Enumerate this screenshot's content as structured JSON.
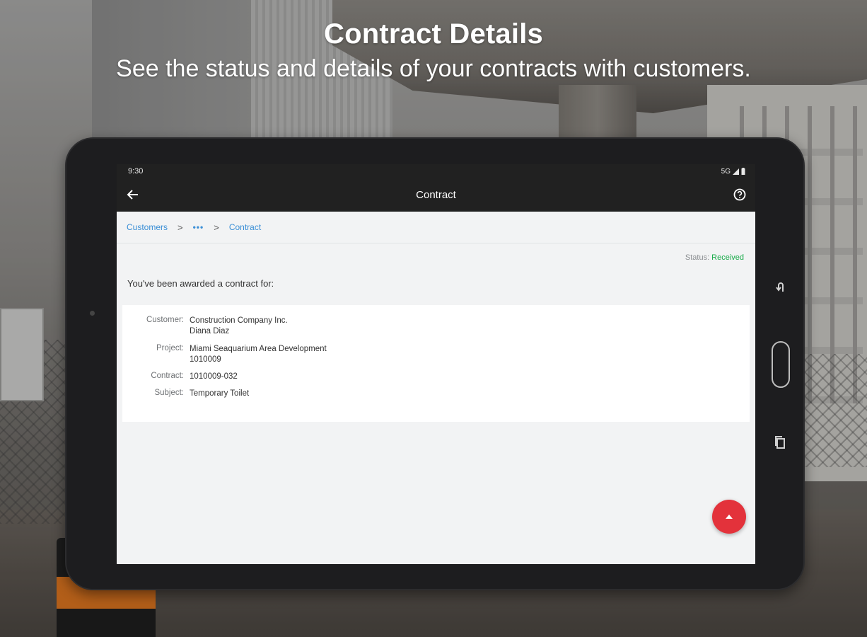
{
  "promo": {
    "headline": "Contract Details",
    "subline": "See the status and details of your contracts with customers."
  },
  "statusbar": {
    "time": "9:30",
    "network": "5G"
  },
  "appbar": {
    "title": "Contract",
    "back_icon": "arrow-left-icon",
    "help_icon": "help-circle-icon"
  },
  "breadcrumb": {
    "items": [
      "Customers",
      "•••",
      "Contract"
    ],
    "separator": ">"
  },
  "status": {
    "label": "Status:",
    "value": "Received",
    "value_color": "#1aab4a"
  },
  "intro": "You've been awarded a contract for:",
  "details": {
    "customer_label": "Customer:",
    "customer_name": "Construction  Company Inc.",
    "customer_contact": "Diana Diaz",
    "project_label": "Project:",
    "project_name": "Miami Seaquarium Area Development",
    "project_number": "1010009",
    "contract_label": "Contract:",
    "contract_number": "1010009-032",
    "subject_label": "Subject:",
    "subject_value": "Temporary Toilet"
  },
  "fab": {
    "icon": "caret-up-icon",
    "color": "#e3323b"
  },
  "colors": {
    "appbar": "#212121",
    "link": "#3b8fd6",
    "screen_bg": "#f2f3f4"
  }
}
